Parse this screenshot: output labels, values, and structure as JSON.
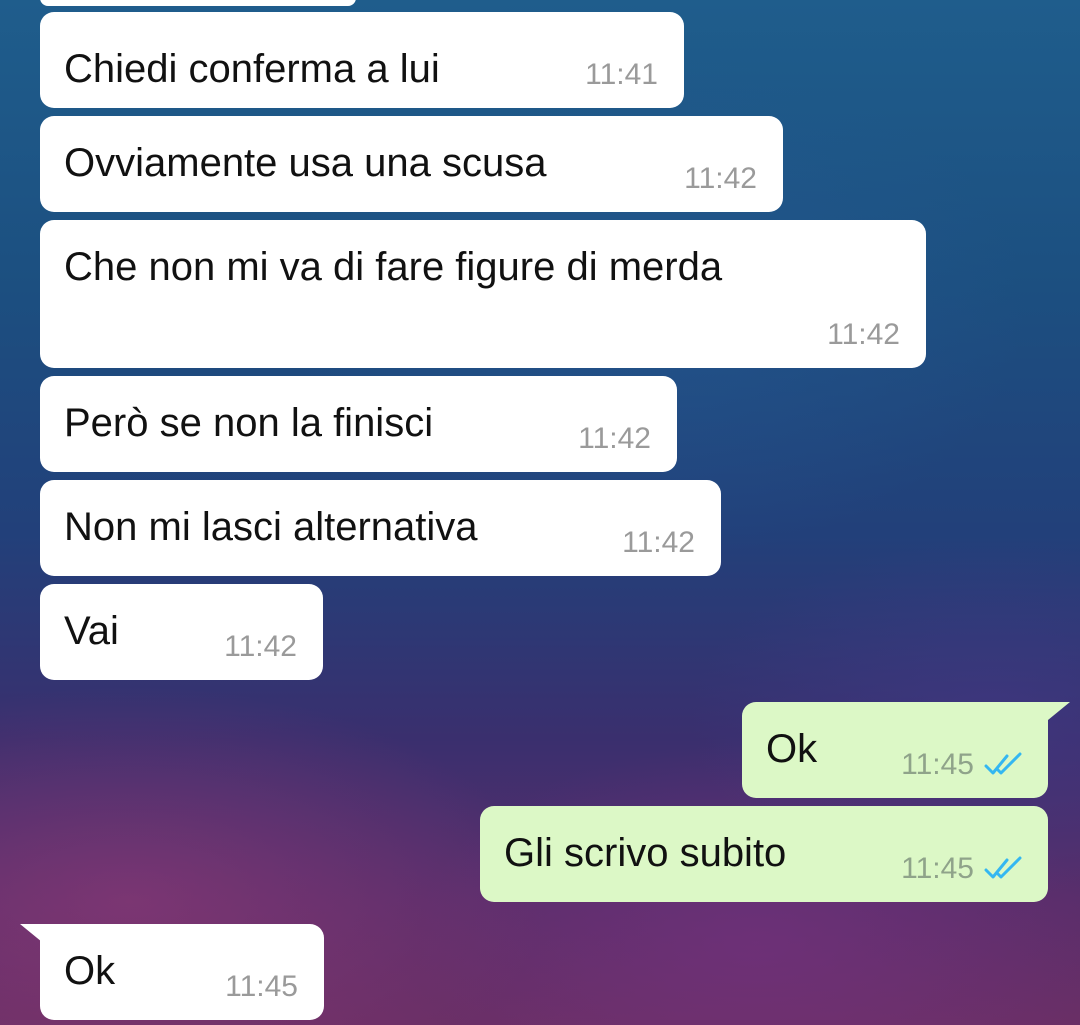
{
  "colors": {
    "incoming_bubble": "#ffffff",
    "outgoing_bubble": "#dcf8c6",
    "timestamp": "#9a9a9a",
    "read_ticks": "#34b7f1"
  },
  "messages": [
    {
      "direction": "incoming",
      "text": "Chiedi conferma a lui",
      "time": "11:41"
    },
    {
      "direction": "incoming",
      "text": "Ovviamente usa una scusa",
      "time": "11:42"
    },
    {
      "direction": "incoming",
      "text": "Che non mi va di fare figure di merda",
      "time": "11:42"
    },
    {
      "direction": "incoming",
      "text": "Però se non la finisci",
      "time": "11:42"
    },
    {
      "direction": "incoming",
      "text": "Non mi lasci alternativa",
      "time": "11:42"
    },
    {
      "direction": "incoming",
      "text": "Vai",
      "time": "11:42"
    },
    {
      "direction": "outgoing",
      "text": "Ok",
      "time": "11:45",
      "status_icon": "double-check-read-icon"
    },
    {
      "direction": "outgoing",
      "text": "Gli scrivo subito",
      "time": "11:45",
      "status_icon": "double-check-read-icon"
    },
    {
      "direction": "incoming",
      "text": "Ok",
      "time": "11:45"
    }
  ]
}
